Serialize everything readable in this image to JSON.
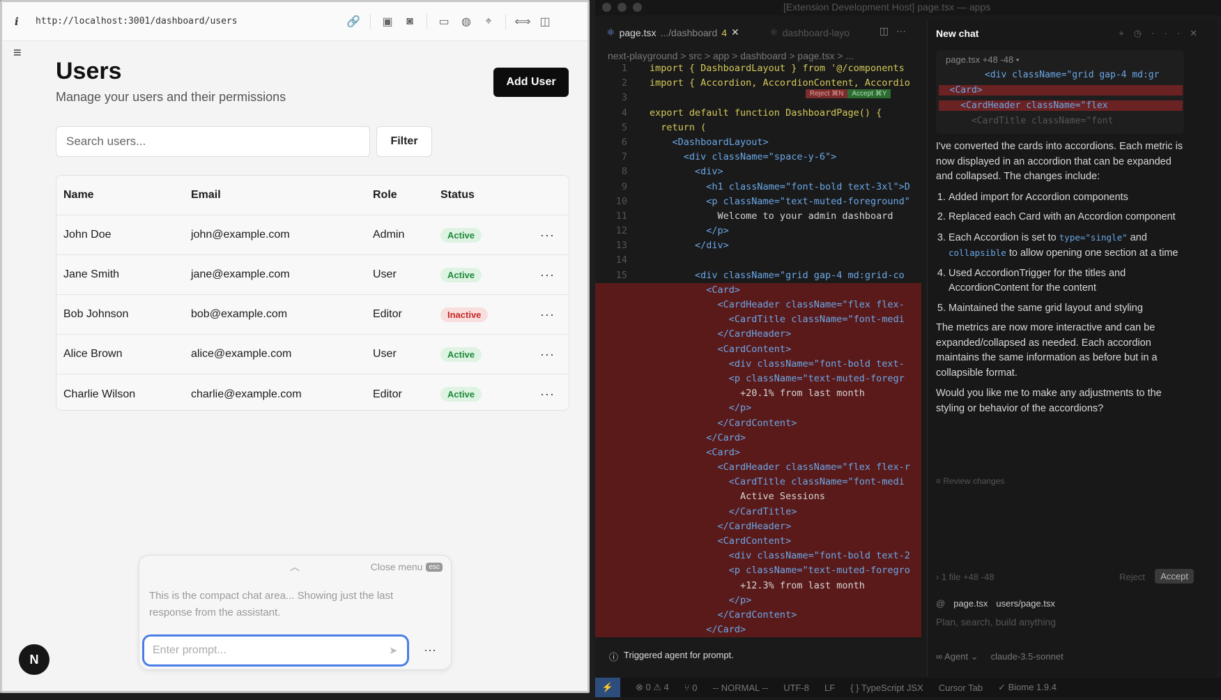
{
  "browser": {
    "url": "http://localhost:3001/dashboard/users",
    "page_title": "Users",
    "page_subtitle": "Manage your users and their permissions",
    "add_user_label": "Add User",
    "search_placeholder": "Search users...",
    "filter_label": "Filter",
    "table": {
      "headers": [
        "Name",
        "Email",
        "Role",
        "Status"
      ],
      "rows": [
        {
          "name": "John Doe",
          "email": "john@example.com",
          "role": "Admin",
          "status": "Active"
        },
        {
          "name": "Jane Smith",
          "email": "jane@example.com",
          "role": "User",
          "status": "Active"
        },
        {
          "name": "Bob Johnson",
          "email": "bob@example.com",
          "role": "Editor",
          "status": "Inactive"
        },
        {
          "name": "Alice Brown",
          "email": "alice@example.com",
          "role": "User",
          "status": "Active"
        },
        {
          "name": "Charlie Wilson",
          "email": "charlie@example.com",
          "role": "Editor",
          "status": "Active"
        }
      ],
      "row_action": "···"
    },
    "compact_chat": {
      "close_menu": "Close menu",
      "esc": "esc",
      "message": "This is the compact chat area... Showing just the last response from the assistant.",
      "prompt_placeholder": "Enter prompt..."
    },
    "logo_letter": "N"
  },
  "editor": {
    "window_title": "[Extension Development Host] page.tsx — apps",
    "tabs": [
      {
        "label": "page.tsx",
        "path": ".../dashboard",
        "count": "4"
      },
      {
        "label": "dashboard-layo"
      }
    ],
    "breadcrumbs": "next-playground > src > app > dashboard > page.tsx > ...",
    "reject_label": "Reject ⌘N",
    "accept_label": "Accept ⌘Y",
    "code_lines": [
      {
        "n": "1",
        "text": "import { DashboardLayout } from '@/components",
        "removed": false
      },
      {
        "n": "2",
        "text": "import { Accordion, AccordionContent, Accordio",
        "removed": false
      },
      {
        "n": "3",
        "text": "",
        "removed": false
      },
      {
        "n": "4",
        "text": "export default function DashboardPage() {",
        "removed": false
      },
      {
        "n": "5",
        "text": "  return (",
        "removed": false
      },
      {
        "n": "6",
        "text": "    <DashboardLayout>",
        "removed": false
      },
      {
        "n": "7",
        "text": "      <div className=\"space-y-6\">",
        "removed": false
      },
      {
        "n": "8",
        "text": "        <div>",
        "removed": false
      },
      {
        "n": "9",
        "text": "          <h1 className=\"font-bold text-3xl\">D",
        "removed": false
      },
      {
        "n": "10",
        "text": "          <p className=\"text-muted-foreground\"",
        "removed": false
      },
      {
        "n": "11",
        "text": "            Welcome to your admin dashboard",
        "removed": false
      },
      {
        "n": "12",
        "text": "          </p>",
        "removed": false
      },
      {
        "n": "13",
        "text": "        </div>",
        "removed": false
      },
      {
        "n": "14",
        "text": "",
        "removed": false
      },
      {
        "n": "15",
        "text": "        <div className=\"grid gap-4 md:grid-co",
        "removed": false
      },
      {
        "n": "",
        "text": "          <Card>",
        "removed": true
      },
      {
        "n": "",
        "text": "            <CardHeader className=\"flex flex-",
        "removed": true
      },
      {
        "n": "",
        "text": "              <CardTitle className=\"font-medi",
        "removed": true
      },
      {
        "n": "",
        "text": "            </CardHeader>",
        "removed": true
      },
      {
        "n": "",
        "text": "            <CardContent>",
        "removed": true
      },
      {
        "n": "",
        "text": "              <div className=\"font-bold text-",
        "removed": true
      },
      {
        "n": "",
        "text": "              <p className=\"text-muted-foregr",
        "removed": true
      },
      {
        "n": "",
        "text": "                +20.1% from last month",
        "removed": true
      },
      {
        "n": "",
        "text": "              </p>",
        "removed": true
      },
      {
        "n": "",
        "text": "            </CardContent>",
        "removed": true
      },
      {
        "n": "",
        "text": "          </Card>",
        "removed": true
      },
      {
        "n": "",
        "text": "          <Card>",
        "removed": true
      },
      {
        "n": "",
        "text": "            <CardHeader className=\"flex flex-r",
        "removed": true
      },
      {
        "n": "",
        "text": "              <CardTitle className=\"font-medi",
        "removed": true
      },
      {
        "n": "",
        "text": "                Active Sessions",
        "removed": true
      },
      {
        "n": "",
        "text": "              </CardTitle>",
        "removed": true
      },
      {
        "n": "",
        "text": "            </CardHeader>",
        "removed": true
      },
      {
        "n": "",
        "text": "            <CardContent>",
        "removed": true
      },
      {
        "n": "",
        "text": "              <div className=\"font-bold text-2",
        "removed": true
      },
      {
        "n": "",
        "text": "              <p className=\"text-muted-foregro",
        "removed": true
      },
      {
        "n": "",
        "text": "                +12.3% from last month",
        "removed": true
      },
      {
        "n": "",
        "text": "              </p>",
        "removed": true
      },
      {
        "n": "",
        "text": "            </CardContent>",
        "removed": true
      },
      {
        "n": "",
        "text": "          </Card>",
        "removed": true
      }
    ],
    "toast": "Triggered agent for prompt.",
    "status_bar": {
      "problems": "⊗ 0 ⚠ 4",
      "ports": "⑂ 0",
      "mode": "-- NORMAL --",
      "encoding": "UTF-8",
      "eol": "LF",
      "language": "{ } TypeScript JSX",
      "cursor_tab": "Cursor Tab",
      "biome": "✓ Biome 1.9.4"
    }
  },
  "chat": {
    "title": "New chat",
    "diff_file": "page.tsx +48 -48 •",
    "diff_lines": [
      "<div className=\"grid gap-4 md:gr",
      "  <Card>",
      "    <CardHeader className=\"flex",
      "      <CardTitle className=\"font"
    ],
    "intro": "I've converted the cards into accordions. Each metric is now displayed in an accordion that can be expanded and collapsed. The changes include:",
    "steps": [
      {
        "pre": "Added import for Accordion components"
      },
      {
        "pre": "Replaced each Card with an Accordion component"
      },
      {
        "pre": "Each Accordion is set to ",
        "code1": "type=\"single\"",
        "mid": " and ",
        "code2": "collapsible",
        "post": " to allow opening one section at a time"
      },
      {
        "pre": "Used AccordionTrigger for the titles and AccordionContent for the content"
      },
      {
        "pre": "Maintained the same grid layout and styling"
      }
    ],
    "outro1": "The metrics are now more interactive and can be expanded/collapsed as needed. Each accordion maintains the same information as before but in a collapsible format.",
    "outro2": "Would you like me to make any adjustments to the styling or behavior of the accordions?",
    "review": "≡ Review changes",
    "file_summary": "› 1 file +48 -48",
    "reject": "Reject",
    "accept": "Accept",
    "ctx_files": [
      "page.tsx",
      "users/page.tsx"
    ],
    "input_placeholder": "Plan, search, build anything",
    "agent": "∞ Agent ⌄",
    "model": "claude-3.5-sonnet"
  },
  "colors": {
    "accent_blue": "#4a7de8",
    "active_green": "#1e8a3a",
    "inactive_red": "#c42828",
    "removed_bg": "#5a1a1a"
  }
}
